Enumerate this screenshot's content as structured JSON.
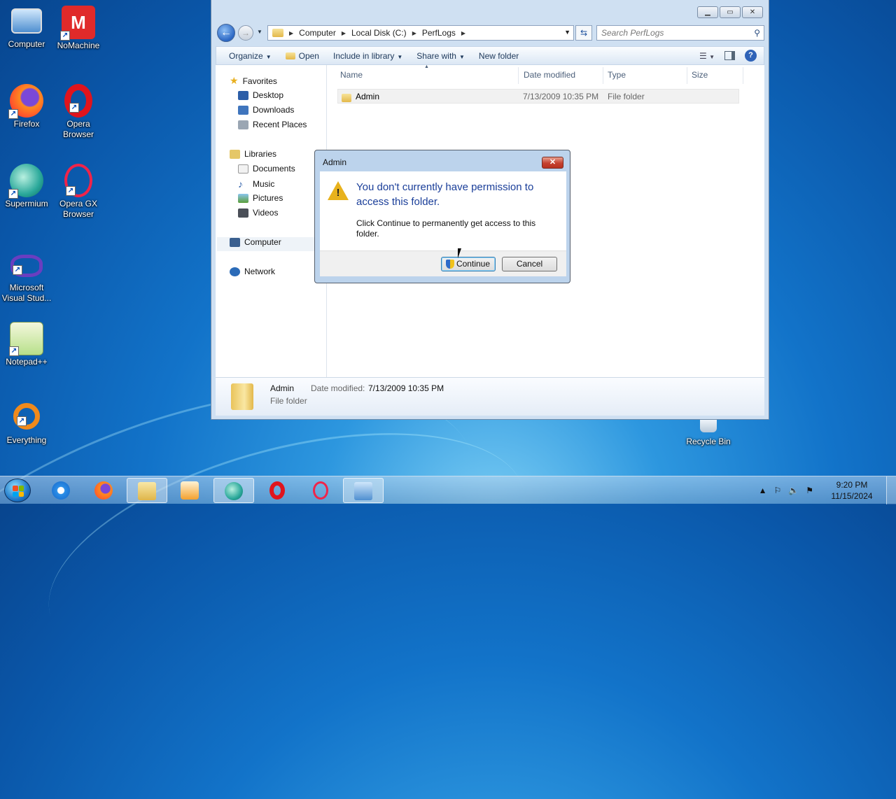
{
  "desktop": {
    "icons": [
      {
        "label": "Computer",
        "icon": "computer-icon"
      },
      {
        "label": "NoMachine",
        "icon": "nomachine-icon"
      },
      {
        "label": "Firefox",
        "icon": "firefox-icon"
      },
      {
        "label": "Opera Browser",
        "icon": "opera-icon"
      },
      {
        "label": "Supermium",
        "icon": "supermium-icon"
      },
      {
        "label": "Opera GX Browser",
        "icon": "opera-gx-icon"
      },
      {
        "label": "Microsoft Visual Stud...",
        "icon": "visual-studio-icon"
      },
      {
        "label": "Notepad++",
        "icon": "notepad-plus-plus-icon"
      },
      {
        "label": "Everything",
        "icon": "everything-icon"
      },
      {
        "label": "Recycle Bin",
        "icon": "recycle-bin-icon"
      }
    ]
  },
  "explorer": {
    "breadcrumb": [
      "Computer",
      "Local Disk (C:)",
      "PerfLogs"
    ],
    "search_placeholder": "Search PerfLogs",
    "toolbar": {
      "organize": "Organize",
      "open": "Open",
      "include": "Include in library",
      "share": "Share with",
      "new_folder": "New folder"
    },
    "nav": {
      "favorites": "Favorites",
      "desktop": "Desktop",
      "downloads": "Downloads",
      "recent": "Recent Places",
      "libraries": "Libraries",
      "documents": "Documents",
      "music": "Music",
      "pictures": "Pictures",
      "videos": "Videos",
      "computer": "Computer",
      "network": "Network"
    },
    "columns": {
      "name": "Name",
      "date": "Date modified",
      "type": "Type",
      "size": "Size"
    },
    "files": [
      {
        "name": "Admin",
        "date": "7/13/2009 10:35 PM",
        "type": "File folder",
        "size": ""
      }
    ],
    "details": {
      "name": "Admin",
      "date_label": "Date modified:",
      "date_value": "7/13/2009 10:35 PM",
      "type": "File folder"
    }
  },
  "dialog": {
    "title": "Admin",
    "main_text": "You don't currently have permission to access this folder.",
    "sub_text": "Click Continue to permanently get access to this folder.",
    "continue_label": "Continue",
    "cancel_label": "Cancel"
  },
  "taskbar": {
    "apps": [
      "internet-explorer-icon",
      "firefox-icon",
      "file-explorer-icon",
      "media-player-icon",
      "supermium-icon",
      "opera-icon",
      "opera-gx-icon",
      "control-panel-icon"
    ],
    "time": "9:20 PM",
    "date": "11/15/2024"
  }
}
